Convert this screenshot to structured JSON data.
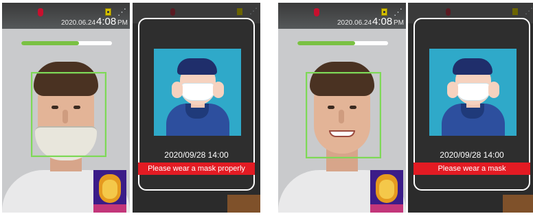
{
  "device_screens": [
    {
      "status": {
        "temperature_icon": "thermometer-icon",
        "sd_icon": "sd-card-icon",
        "network_icon": "network-icon",
        "date": "2020.06.24",
        "time": "4:08",
        "meridiem": "PM"
      },
      "progress": 0.64,
      "mask_state": "mask-below-nose",
      "expression": "smile"
    },
    {
      "status": {
        "temperature_icon": "thermometer-icon",
        "sd_icon": "sd-card-icon",
        "network_icon": "network-icon",
        "date": "2020.06.24",
        "time": "4:08",
        "meridiem": "PM"
      },
      "progress": 0.64,
      "mask_state": "no-mask",
      "expression": "smile"
    }
  ],
  "alert_screens": [
    {
      "datetime": "2020/09/28 14:00",
      "message": "Please wear a mask properly",
      "message_color": "#e31b23"
    },
    {
      "datetime": "2020/09/28 14:00",
      "message": "Please wear a mask",
      "message_color": "#e31b23"
    }
  ],
  "colors": {
    "accent_green": "#7ed957",
    "warning_red": "#e31b23"
  }
}
